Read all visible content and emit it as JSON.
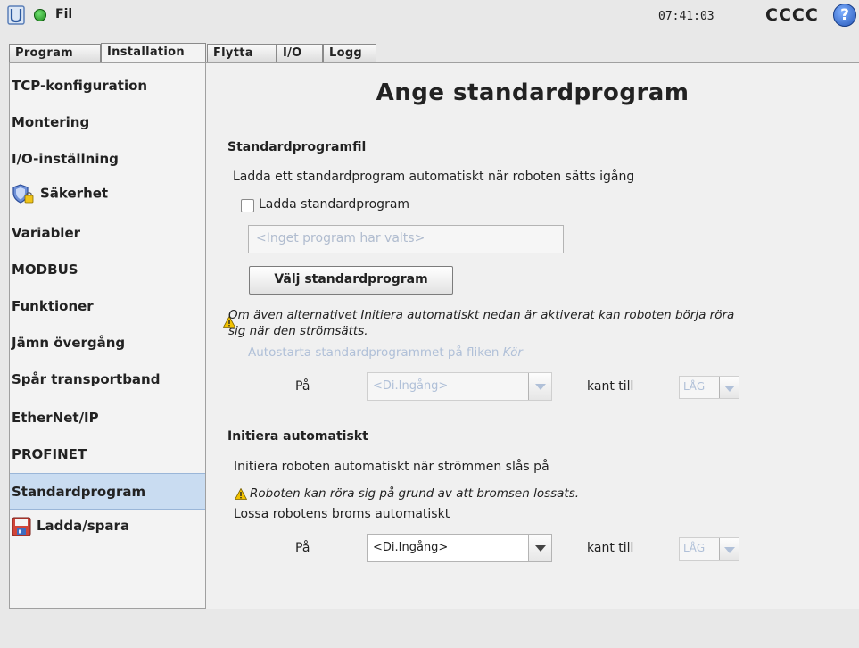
{
  "header": {
    "file_label": "Fil",
    "clock": "07:41:03",
    "robot_name": "CCCC",
    "help_glyph": "?",
    "icons": {
      "logo": "ur-logo-icon",
      "status": "status-ok-icon",
      "help": "help-icon"
    }
  },
  "tabs": [
    {
      "label": "Program",
      "active": false
    },
    {
      "label": "Installation",
      "active": true
    },
    {
      "label": "Flytta",
      "active": false
    },
    {
      "label": "I/O",
      "active": false
    },
    {
      "label": "Logg",
      "active": false
    }
  ],
  "sidebar": {
    "items": [
      {
        "label": "TCP-konfiguration"
      },
      {
        "label": "Montering"
      },
      {
        "label": "I/O-inställning"
      },
      {
        "label": "Säkerhet",
        "icon": "shield-lock-icon"
      },
      {
        "label": "Variabler"
      },
      {
        "label": "MODBUS"
      },
      {
        "label": "Funktioner"
      },
      {
        "label": "Jämn övergång"
      },
      {
        "label": "Spår transportband"
      },
      {
        "label": "EtherNet/IP"
      },
      {
        "label": "PROFINET"
      },
      {
        "label": "Standardprogram",
        "selected": true
      },
      {
        "label": "Ladda/spara",
        "icon": "save-disk-icon"
      }
    ]
  },
  "main": {
    "title": "Ange standardprogram",
    "default_file": {
      "heading": "Standardprogramfil",
      "description": "Ladda ett standardprogram automatiskt när roboten sätts igång",
      "checkbox_label": "Ladda standardprogram",
      "checkbox_checked": false,
      "program_field_placeholder": "<Inget program har valts>",
      "select_button": "Välj standardprogram",
      "warning_line1": "Om även alternativet Initiera automatiskt nedan är aktiverat kan roboten börja röra",
      "warning_line2": "sig när den strömsätts.",
      "autostart_prefix": "Autostarta standardprogrammet på fliken ",
      "autostart_tab": "Kör",
      "on_label": "På",
      "input_select": "<Di.Ingång>",
      "edge_label": "kant till",
      "level_select": "LÅG"
    },
    "auto_init": {
      "heading": "Initiera automatiskt",
      "description": "Initiera roboten automatiskt när strömmen slås på",
      "warning": "Roboten kan röra sig på grund av att bromsen lossats.",
      "brake_label": "Lossa robotens broms automatiskt",
      "on_label": "På",
      "input_select": "<Di.Ingång>",
      "edge_label": "kant till",
      "level_select": "LÅG"
    },
    "colors": {
      "selected_item": "#c9dcf1",
      "disabled_text": "#b0c0d8",
      "warning": "#f2c200"
    }
  }
}
